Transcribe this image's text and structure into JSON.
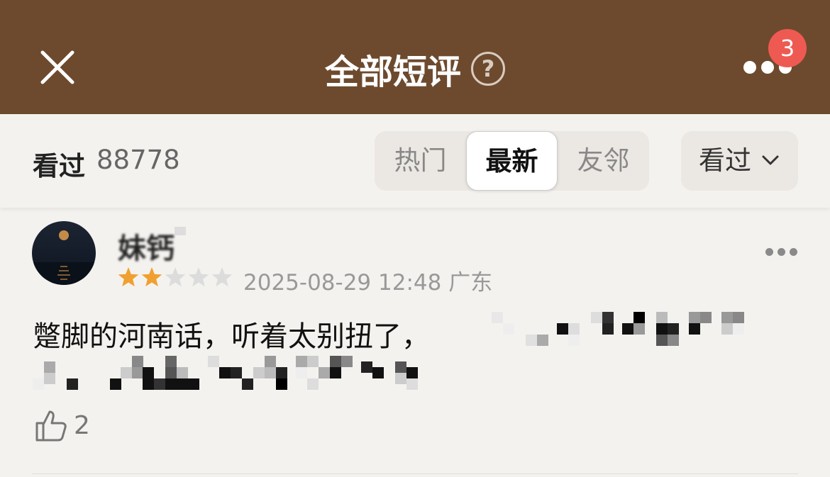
{
  "header": {
    "title": "全部短评",
    "help_glyph": "?",
    "notification_count": "3",
    "background": "#6d4a2e"
  },
  "toolbar": {
    "count_label": "看过",
    "count_value": "88778",
    "tabs": [
      {
        "label": "热门",
        "active": false
      },
      {
        "label": "最新",
        "active": true
      },
      {
        "label": "友邻",
        "active": false
      }
    ],
    "filter_label": "看过"
  },
  "review": {
    "username": "妹钙",
    "rating": 2,
    "rating_max": 5,
    "timestamp": "2025-08-29 12:48",
    "location": "广东",
    "text": "蹩脚的河南话，听着太别扭了，",
    "likes": "2"
  },
  "icons": [
    "close-icon",
    "help-icon",
    "more-icon",
    "chevron-down-icon",
    "star-icon",
    "thumbs-up-icon"
  ],
  "colors": {
    "accent_star": "#f0a030",
    "badge": "#ee5a52"
  }
}
